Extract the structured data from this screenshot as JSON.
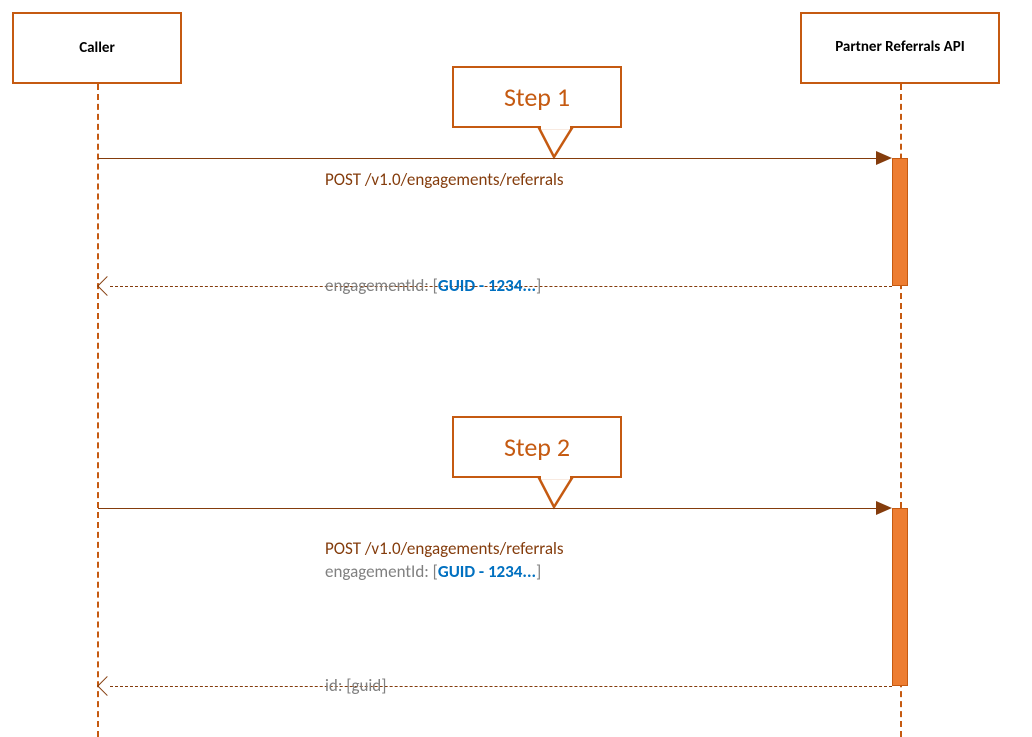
{
  "actors": {
    "caller": "Caller",
    "api": "Partner Referrals API"
  },
  "steps": {
    "step1_label": "Step 1",
    "step1_request": "POST /v1.0/engagements/referrals",
    "step1_response_prefix": "engagementId: [",
    "step1_response_guid": "GUID - 1234...",
    "step1_response_suffix": "]",
    "step2_label": "Step 2",
    "step2_request_line1": "POST /v1.0/engagements/referrals",
    "step2_request_line2_prefix": "engagementId: [",
    "step2_request_line2_guid": "GUID - 1234...",
    "step2_request_line2_suffix": "]",
    "step2_response": "id: [guid]"
  }
}
